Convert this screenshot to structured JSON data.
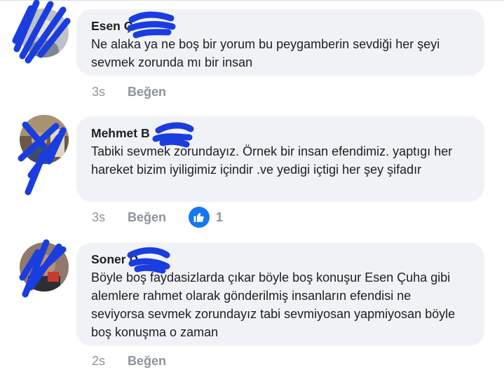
{
  "comments": [
    {
      "author": "Esen Ç",
      "text": "Ne alaka ya ne boş bir yorum bu peygamberin sevdiği her şeyi sevmek zorunda mı bir insan",
      "time": "3s",
      "like_label": "Beğen",
      "reactions": null
    },
    {
      "author": "Mehmet B",
      "text": "Tabiki sevmek zorundayız. Örnek bir insan efendimiz. yaptıgı her hareket bizim iyiligimiz içindir .ve yedigi içtigi her şey şifadır",
      "time": "3s",
      "like_label": "Beğen",
      "reactions": {
        "icon": "thumbs-up-icon",
        "count": "1"
      }
    },
    {
      "author": "Soner D",
      "text": "Böyle boş faydasizlarda çıkar böyle boş konuşur Esen Çuha gibi alemlere rahmet olarak gönderilmiş insanların efendisi ne seviyorsa sevmek zorundayız tabi sevmiyosan yapmiyosan böyle boş konuşma o zaman",
      "time": "2s",
      "like_label": "Beğen",
      "reactions": null
    }
  ],
  "colors": {
    "bubble": "#f0f2f5",
    "meta": "#8d949e",
    "like_blue": "#1877f2",
    "redaction": "#1a3de0"
  }
}
